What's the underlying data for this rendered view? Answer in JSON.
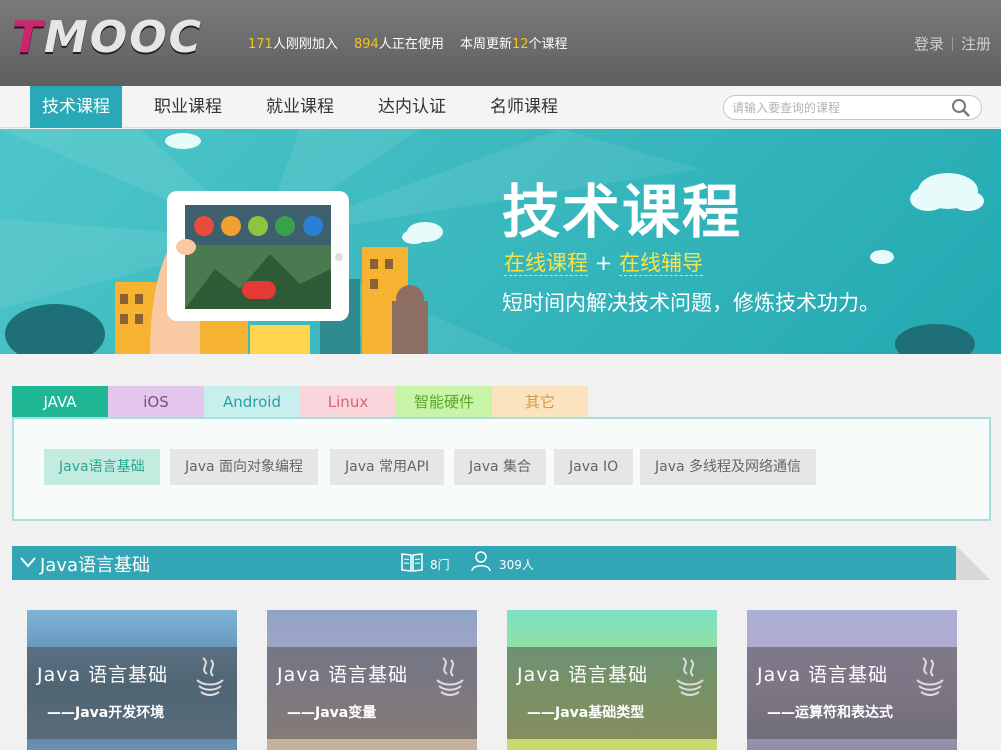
{
  "header": {
    "logo": "TMOOC",
    "stats": {
      "joined_num": "171",
      "joined_label": "人刚刚加入",
      "using_num": "894",
      "using_label": "人正在使用",
      "week_prefix": "本周更新",
      "week_num": "12",
      "week_suffix": "个课程"
    },
    "login": "登录",
    "register": "注册"
  },
  "nav": {
    "items": [
      "技术课程",
      "职业课程",
      "就业课程",
      "达内认证",
      "名师课程"
    ],
    "active": 0,
    "search_placeholder": "请输入要查询的课程"
  },
  "banner": {
    "title": "技术课程",
    "sub_a": "在线课程",
    "plus": "+",
    "sub_b": "在线辅导",
    "desc": "短时间内解决技术问题，修炼技术功力。"
  },
  "category_tabs": [
    {
      "label": "JAVA",
      "bg": "#1fb693",
      "color": "#ffffff"
    },
    {
      "label": "iOS",
      "bg": "#e4c6ec",
      "color": "#7a4d88"
    },
    {
      "label": "Android",
      "bg": "#c9eeee",
      "color": "#2aa0a4"
    },
    {
      "label": "Linux",
      "bg": "#f9d6dc",
      "color": "#d8627a"
    },
    {
      "label": "智能硬件",
      "bg": "#c8f4a8",
      "color": "#5aa629"
    },
    {
      "label": "其它",
      "bg": "#fbe3bf",
      "color": "#d19b46"
    }
  ],
  "subtopics": [
    "Java语言基础",
    "Java 面向对象编程",
    "Java 常用API",
    "Java 集合",
    "Java IO",
    "Java 多线程及网络通信"
  ],
  "section": {
    "title": "Java语言基础",
    "course_count": "8门",
    "learners": "309人"
  },
  "cards": [
    {
      "title": "Java 语言基础",
      "subtitle": "——Java开发环境",
      "bg_top": "#7fb3d8",
      "bg_mid": "#4f7fa0",
      "bg_bottom": "#6a8fb0"
    },
    {
      "title": "Java 语言基础",
      "subtitle": "——Java变量",
      "bg_top": "#8fa3c7",
      "bg_mid": "#b0a7c2",
      "bg_bottom": "#c7b39a"
    },
    {
      "title": "Java 语言基础",
      "subtitle": "——Java基础类型",
      "bg_top": "#7de0c6",
      "bg_mid": "#a7e07f",
      "bg_bottom": "#c9d96e"
    },
    {
      "title": "Java 语言基础",
      "subtitle": "——运算符和表达式",
      "bg_top": "#aab0d8",
      "bg_mid": "#b9a3c4",
      "bg_bottom": "#8d8ea8"
    }
  ],
  "colors": {
    "accent": "#29a8b7",
    "highlight": "#f0c41b"
  }
}
